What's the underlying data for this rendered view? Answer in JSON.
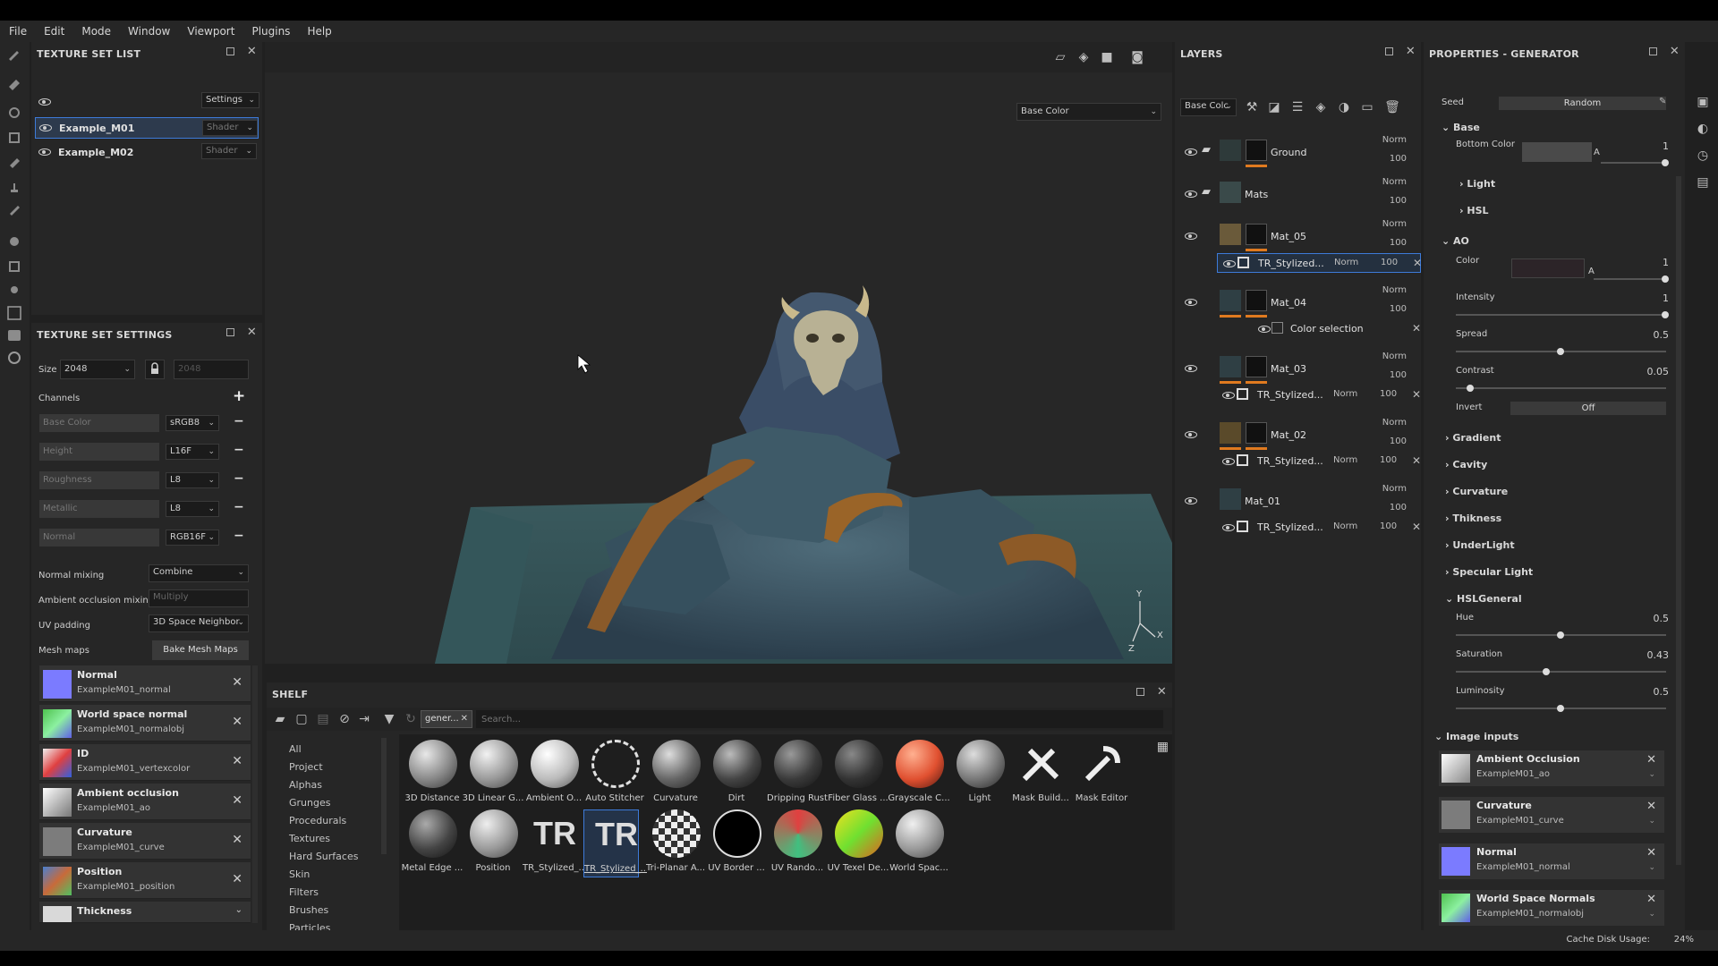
{
  "menu": [
    "File",
    "Edit",
    "Mode",
    "Window",
    "Viewport",
    "Plugins",
    "Help"
  ],
  "texture_set_list": {
    "title": "TEXTURE SET LIST",
    "settings_label": "Settings",
    "sets": [
      {
        "name": "Example_M01",
        "shader": "Shader"
      },
      {
        "name": "Example_M02",
        "shader": "Shader"
      }
    ]
  },
  "texture_set_settings": {
    "title": "TEXTURE SET SETTINGS",
    "size_label": "Size",
    "size_value": "2048",
    "size_linked": "2048",
    "channels_label": "Channels",
    "channels": [
      {
        "name": "Base Color",
        "format": "sRGB8"
      },
      {
        "name": "Height",
        "format": "L16F"
      },
      {
        "name": "Roughness",
        "format": "L8"
      },
      {
        "name": "Metallic",
        "format": "L8"
      },
      {
        "name": "Normal",
        "format": "RGB16F"
      }
    ],
    "normal_mixing_label": "Normal mixing",
    "normal_mixing_value": "Combine",
    "ao_mixing_label": "Ambient occlusion mixing",
    "ao_mixing_value": "Multiply",
    "uv_padding_label": "UV padding",
    "uv_padding_value": "3D Space Neighbor",
    "mesh_maps_label": "Mesh maps",
    "bake_button": "Bake Mesh Maps",
    "mesh_maps": [
      {
        "name": "Normal",
        "file": "ExampleM01_normal",
        "color": "#7b7bff"
      },
      {
        "name": "World space normal",
        "file": "ExampleM01_normalobj",
        "color": "#5fbf5f"
      },
      {
        "name": "ID",
        "file": "ExampleM01_vertexcolor",
        "color": "#e8e8e8"
      },
      {
        "name": "Ambient occlusion",
        "file": "ExampleM01_ao",
        "color": "#cfcfcf"
      },
      {
        "name": "Curvature",
        "file": "ExampleM01_curve",
        "color": "#8a8a8a"
      },
      {
        "name": "Position",
        "file": "ExampleM01_position",
        "color": "#c86a3a"
      },
      {
        "name": "Thickness",
        "file": "",
        "color": "#d9d9d9"
      }
    ]
  },
  "viewport": {
    "channel_select": "Base Color",
    "axis_y": "Y",
    "axis_x": "X",
    "axis_z": "Z"
  },
  "shelf": {
    "title": "SHELF",
    "filter_tag": "gener...",
    "search_placeholder": "Search...",
    "categories": [
      "All",
      "Project",
      "Alphas",
      "Grunges",
      "Procedurals",
      "Textures",
      "Hard Surfaces",
      "Skin",
      "Filters",
      "Brushes",
      "Particles"
    ],
    "items": [
      {
        "label": "3D Distance",
        "style": "grey"
      },
      {
        "label": "3D Linear G...",
        "style": "grey"
      },
      {
        "label": "Ambient O...",
        "style": "light"
      },
      {
        "label": "Auto Stitcher",
        "style": "dashed"
      },
      {
        "label": "Curvature",
        "style": "dark"
      },
      {
        "label": "Dirt",
        "style": "dark"
      },
      {
        "label": "Dripping Rust",
        "style": "dark"
      },
      {
        "label": "Fiber Glass ...",
        "style": "dark"
      },
      {
        "label": "Grayscale C...",
        "style": "red"
      },
      {
        "label": "Light",
        "style": "grey"
      },
      {
        "label": "Mask Build...",
        "style": "tool"
      },
      {
        "label": "Mask Editor",
        "style": "tool"
      },
      {
        "label": "Metal Edge ...",
        "style": "dark"
      },
      {
        "label": "Position",
        "style": "grey"
      },
      {
        "label": "TR_Stylized_...",
        "style": "tr"
      },
      {
        "label": "TR_Stylized_...",
        "style": "tr-selected"
      },
      {
        "label": "Tri-Planar A...",
        "style": "checker"
      },
      {
        "label": "UV Border ...",
        "style": "uvborder"
      },
      {
        "label": "UV Rando...",
        "style": "uvrandom"
      },
      {
        "label": "UV Texel De...",
        "style": "texel"
      },
      {
        "label": "World Spac...",
        "style": "grey"
      }
    ]
  },
  "layers": {
    "title": "LAYERS",
    "channel": "Base Colc",
    "rows": [
      {
        "name": "Ground",
        "blend": "Norm",
        "opacity": "100",
        "folder": true
      },
      {
        "name": "Mats",
        "blend": "Norm",
        "opacity": "100",
        "folder": true
      },
      {
        "name": "Mat_05",
        "blend": "Norm",
        "opacity": "100",
        "folder": false
      },
      {
        "name": "Mat_04",
        "blend": "Norm",
        "opacity": "100",
        "folder": false
      },
      {
        "name": "Mat_03",
        "blend": "Norm",
        "opacity": "100",
        "folder": false
      },
      {
        "name": "Mat_02",
        "blend": "Norm",
        "opacity": "100",
        "folder": false
      },
      {
        "name": "Mat_01",
        "blend": "Norm",
        "opacity": "100",
        "folder": false
      }
    ],
    "effects": [
      {
        "name": "TR_Stylized...",
        "blend": "Norm",
        "opacity": "100"
      },
      {
        "name": "Color selection"
      },
      {
        "name": "TR_Stylized...",
        "blend": "Norm",
        "opacity": "100"
      },
      {
        "name": "TR_Stylized...",
        "blend": "Norm",
        "opacity": "100"
      },
      {
        "name": "TR_Stylized...",
        "blend": "Norm",
        "opacity": "100"
      }
    ]
  },
  "properties": {
    "title": "PROPERTIES - GENERATOR",
    "seed_label": "Seed",
    "seed_value": "Random",
    "base_label": "Base",
    "bottom_color_label": "Bottom Color",
    "bottom_color_alpha_label": "A",
    "bottom_color_alpha": "1",
    "light_label": "Light",
    "hsl_label": "HSL",
    "ao_label": "AO",
    "ao_color_label": "Color",
    "ao_color_alpha_label": "A",
    "ao_color_alpha": "1",
    "intensity_label": "Intensity",
    "intensity": "1",
    "spread_label": "Spread",
    "spread": "0.5",
    "contrast_label": "Contrast",
    "contrast": "0.05",
    "invert_label": "Invert",
    "invert_value": "Off",
    "collapsed_sections": [
      "Gradient",
      "Cavity",
      "Curvature",
      "Thikness",
      "UnderLight",
      "Specular Light"
    ],
    "hslgeneral_label": "HSLGeneral",
    "hue_label": "Hue",
    "hue": "0.5",
    "saturation_label": "Saturation",
    "saturation": "0.43",
    "luminosity_label": "Luminosity",
    "luminosity": "0.5",
    "image_inputs_label": "Image inputs",
    "image_inputs": [
      {
        "name": "Ambient Occlusion",
        "file": "ExampleM01_ao",
        "color": "#d0d0d0"
      },
      {
        "name": "Curvature",
        "file": "ExampleM01_curve",
        "color": "#8a8a8a"
      },
      {
        "name": "Normal",
        "file": "ExampleM01_normal",
        "color": "#7b7bff"
      },
      {
        "name": "World Space Normals",
        "file": "ExampleM01_normalobj",
        "color": "#5fbf5f"
      }
    ]
  },
  "status": {
    "cache_label": "Cache Disk Usage:",
    "cache_value": "24%"
  },
  "colors": {
    "accent": "#3d7bd9",
    "orange": "#e07a1f"
  }
}
